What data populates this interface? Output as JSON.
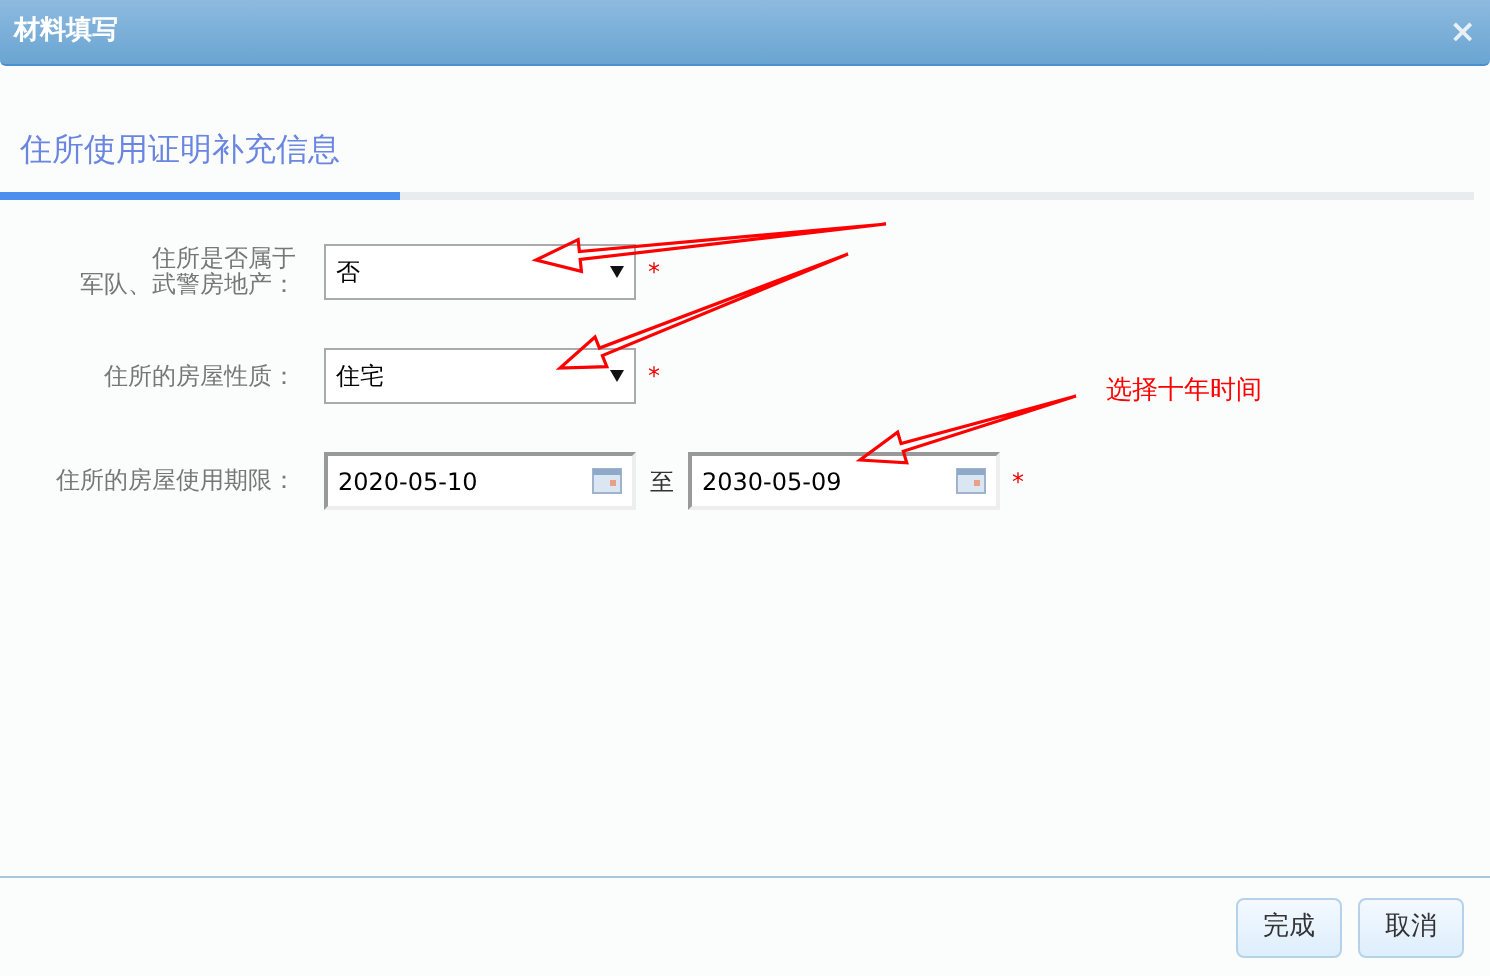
{
  "dialog": {
    "title": "材料填写",
    "close": "×"
  },
  "section": {
    "title": "住所使用证明补充信息"
  },
  "fields": [
    {
      "kind": "select",
      "label": [
        "住所是否属于",
        "军队、武警房地产："
      ],
      "value": "否",
      "required": "*"
    },
    {
      "kind": "select",
      "label": [
        "住所的房屋性质："
      ],
      "value": "住宅",
      "required": "*"
    },
    {
      "kind": "daterange",
      "label": [
        "住所的房屋使用期限："
      ],
      "from": "2020-05-10",
      "separator": "至",
      "to": "2030-05-09",
      "required": "*"
    }
  ],
  "annotation": {
    "text": "选择十年时间"
  },
  "buttons": [
    "完成",
    "取消"
  ]
}
